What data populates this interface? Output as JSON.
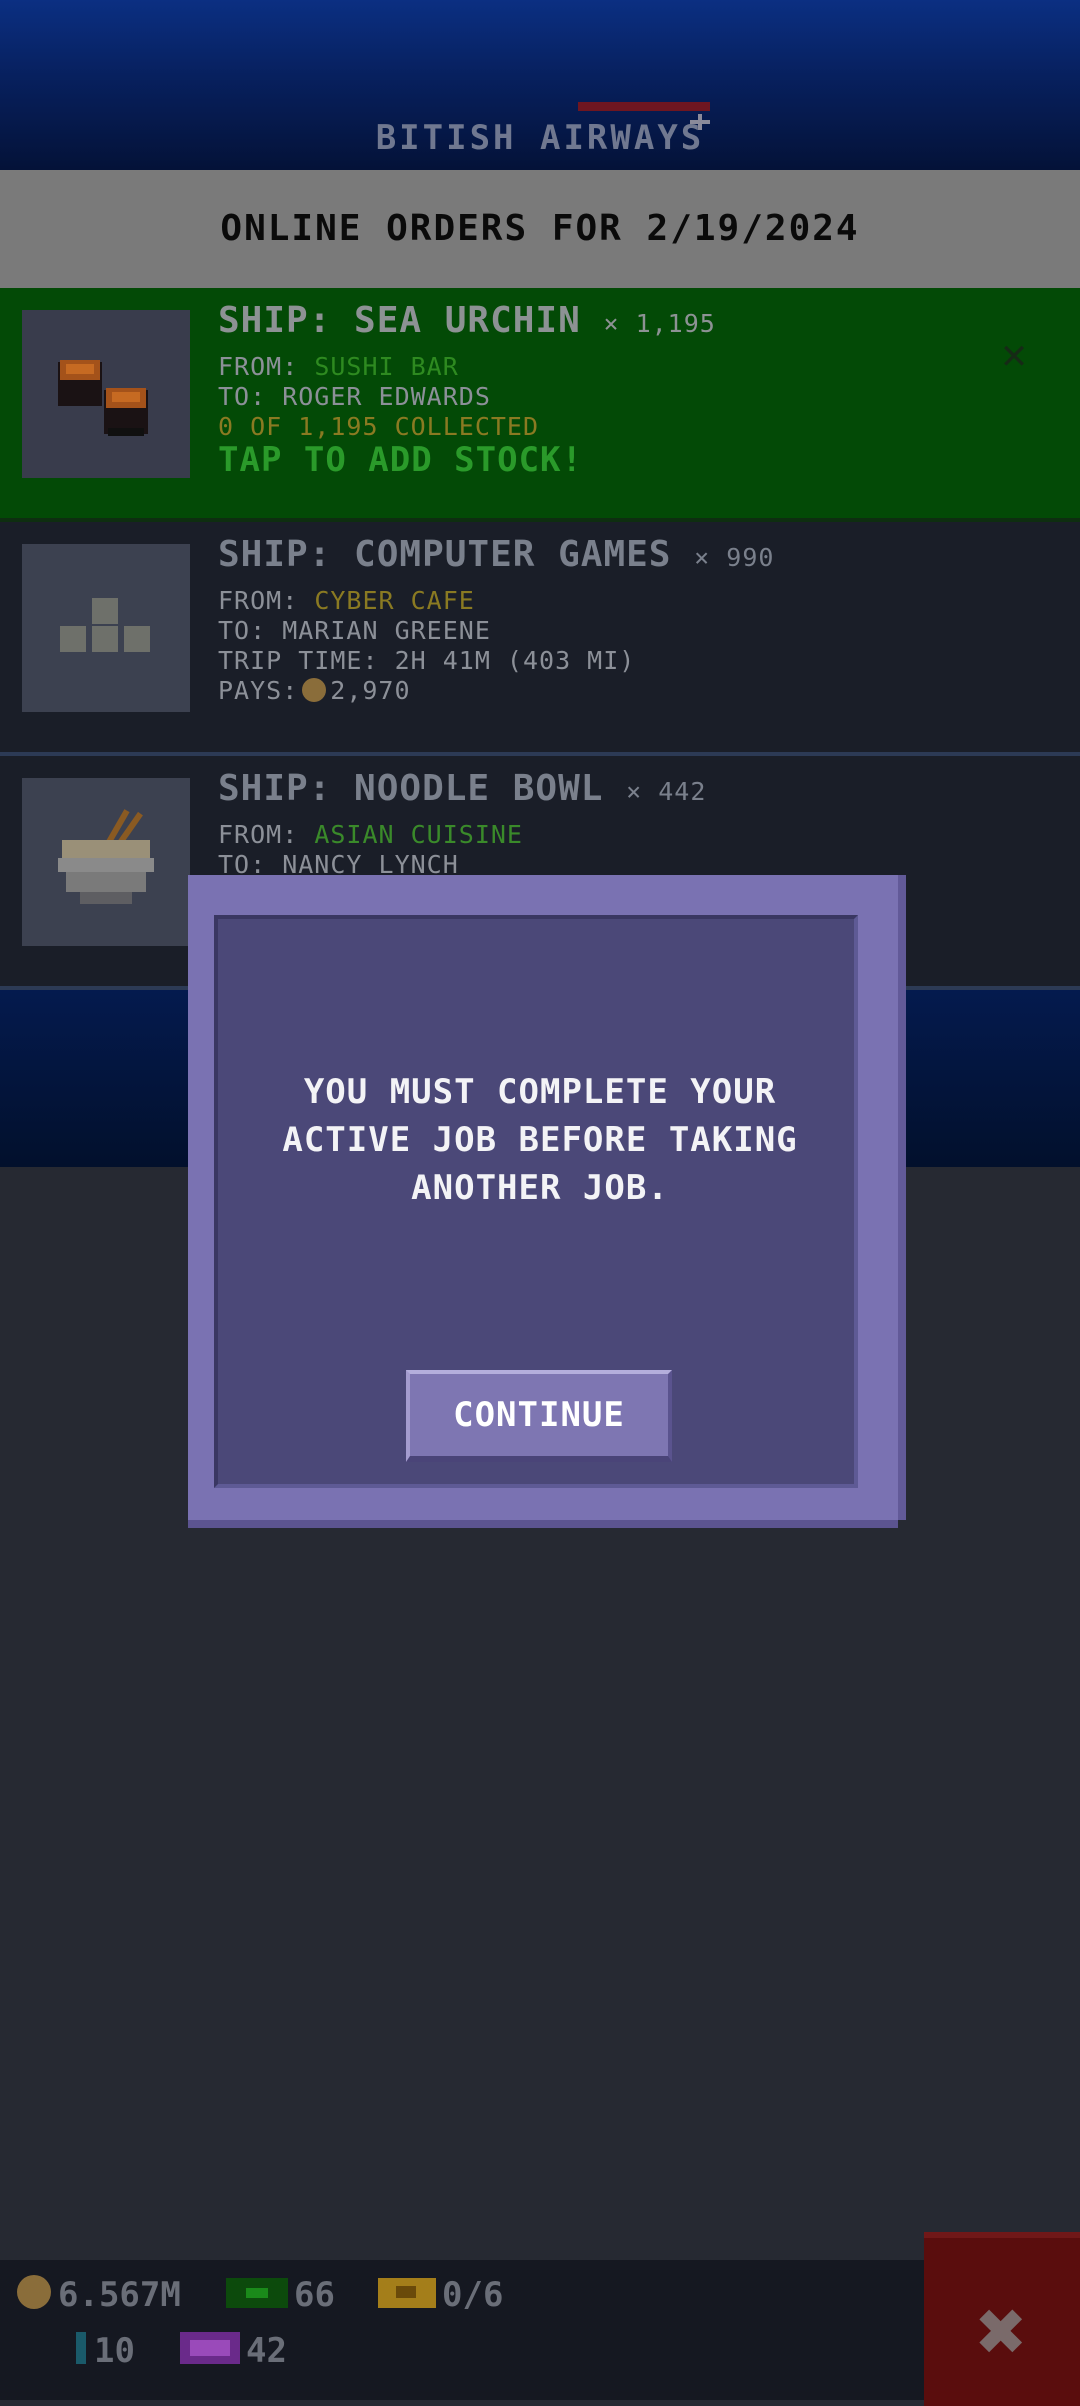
{
  "header": {
    "airline_name": "BITISH AIRWAYS"
  },
  "title_bar": {
    "title": "ONLINE ORDERS FOR 2/19/2024"
  },
  "orders": [
    {
      "ship": "SHIP: SEA URCHIN",
      "qty": "× 1,195",
      "from_label": "FROM: ",
      "from_value": "SUSHI BAR",
      "to": "TO: ROGER EDWARDS",
      "collected": "0 OF 1,195 COLLECTED",
      "cta": "TAP TO ADD STOCK!",
      "icon": "sushi-roll-icon",
      "close_icon": "close-icon"
    },
    {
      "ship": "SHIP: COMPUTER GAMES",
      "qty": "× 990",
      "from_label": "FROM: ",
      "from_value": "CYBER CAFE",
      "to": "TO: MARIAN GREENE",
      "trip": "TRIP TIME: 2H 41M (403 MI)",
      "pays_label": "PAYS:",
      "pays_value": "2,970",
      "icon": "tetris-block-icon"
    },
    {
      "ship": "SHIP: NOODLE BOWL",
      "qty": "× 442",
      "from_label": "FROM: ",
      "from_value": "ASIAN CUISINE",
      "to": "TO: NANCY LYNCH",
      "icon": "noodle-bowl-icon"
    }
  ],
  "modal": {
    "message_line1": "YOU MUST COMPLETE YOUR",
    "message_line2": "ACTIVE JOB BEFORE TAKING",
    "message_line3": "ANOTHER JOB.",
    "continue_label": "CONTINUE"
  },
  "bottom_bar": {
    "coins": "6.567M",
    "bux": "66",
    "tickets": "0/6",
    "elevator": "10",
    "vip": "42"
  },
  "colors": {
    "active_order_bg": "#034a06",
    "modal_frame": "#7a72b2",
    "modal_inner": "#4b4878",
    "header_blue": "#07205e"
  }
}
